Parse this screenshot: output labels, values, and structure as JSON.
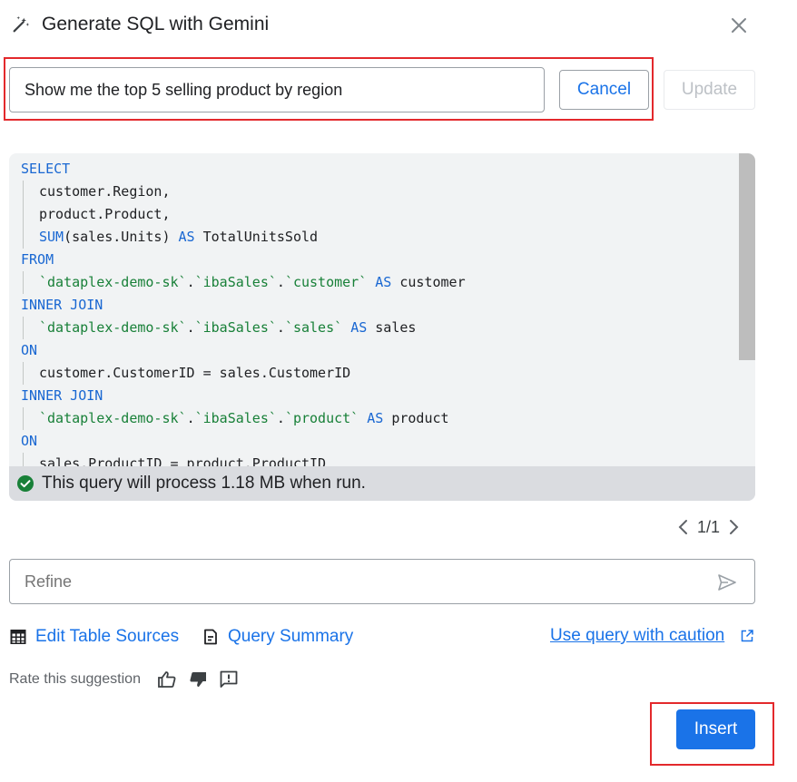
{
  "header": {
    "title": "Generate SQL with Gemini",
    "title_icon": "magic-pen-icon",
    "close_icon": "close-icon"
  },
  "prompt": {
    "value": "Show me the top 5 selling product by region",
    "cancel_label": "Cancel",
    "update_label": "Update"
  },
  "code": {
    "lines": [
      {
        "type": "kw",
        "parts": [
          {
            "t": "SELECT",
            "c": "kw"
          }
        ]
      },
      {
        "type": "indent",
        "parts": [
          {
            "t": "customer.Region,",
            "c": ""
          }
        ]
      },
      {
        "type": "indent",
        "parts": [
          {
            "t": "product.Product,",
            "c": ""
          }
        ]
      },
      {
        "type": "indent",
        "parts": [
          {
            "t": "SUM",
            "c": "kw"
          },
          {
            "t": "(sales.Units) ",
            "c": ""
          },
          {
            "t": "AS",
            "c": "kw"
          },
          {
            "t": " TotalUnitsSold",
            "c": ""
          }
        ]
      },
      {
        "type": "kw",
        "parts": [
          {
            "t": "FROM",
            "c": "kw"
          }
        ]
      },
      {
        "type": "indent",
        "parts": [
          {
            "t": "`dataplex-demo-sk`",
            "c": "str"
          },
          {
            "t": ".",
            "c": ""
          },
          {
            "t": "`ibaSales`",
            "c": "str"
          },
          {
            "t": ".",
            "c": ""
          },
          {
            "t": "`customer`",
            "c": "str"
          },
          {
            "t": " ",
            "c": ""
          },
          {
            "t": "AS",
            "c": "kw"
          },
          {
            "t": " customer",
            "c": ""
          }
        ]
      },
      {
        "type": "kw",
        "parts": [
          {
            "t": "INNER JOIN",
            "c": "kw"
          }
        ]
      },
      {
        "type": "indent",
        "parts": [
          {
            "t": "`dataplex-demo-sk`",
            "c": "str"
          },
          {
            "t": ".",
            "c": ""
          },
          {
            "t": "`ibaSales`",
            "c": "str"
          },
          {
            "t": ".",
            "c": ""
          },
          {
            "t": "`sales`",
            "c": "str"
          },
          {
            "t": " ",
            "c": ""
          },
          {
            "t": "AS",
            "c": "kw"
          },
          {
            "t": " sales",
            "c": ""
          }
        ]
      },
      {
        "type": "kw",
        "parts": [
          {
            "t": "ON",
            "c": "kw"
          }
        ]
      },
      {
        "type": "indent",
        "parts": [
          {
            "t": "customer.CustomerID = sales.CustomerID",
            "c": ""
          }
        ]
      },
      {
        "type": "kw",
        "parts": [
          {
            "t": "INNER JOIN",
            "c": "kw"
          }
        ]
      },
      {
        "type": "indent",
        "parts": [
          {
            "t": "`dataplex-demo-sk`",
            "c": "str"
          },
          {
            "t": ".",
            "c": ""
          },
          {
            "t": "`ibaSales`",
            "c": "str"
          },
          {
            "t": ".",
            "c": ""
          },
          {
            "t": "`product`",
            "c": "str"
          },
          {
            "t": " ",
            "c": ""
          },
          {
            "t": "AS",
            "c": "kw"
          },
          {
            "t": " product",
            "c": ""
          }
        ]
      },
      {
        "type": "kw",
        "parts": [
          {
            "t": "ON",
            "c": "kw"
          }
        ]
      },
      {
        "type": "indent",
        "parts": [
          {
            "t": "sales.ProductID = product.ProductID",
            "c": ""
          }
        ]
      }
    ],
    "status_text": "This query will process 1.18 MB when run.",
    "status_icon": "check-circle-icon"
  },
  "pager": {
    "text": "1/1"
  },
  "refine": {
    "placeholder": "Refine",
    "send_icon": "send-icon"
  },
  "links": {
    "edit_sources": "Edit Table Sources",
    "query_summary": "Query Summary",
    "caution": "Use query with caution"
  },
  "rate": {
    "label": "Rate this suggestion"
  },
  "insert_label": "Insert",
  "colors": {
    "accent": "#1a73e8",
    "keyword": "#1967d2",
    "string": "#188038",
    "highlight": "#e3292c"
  }
}
